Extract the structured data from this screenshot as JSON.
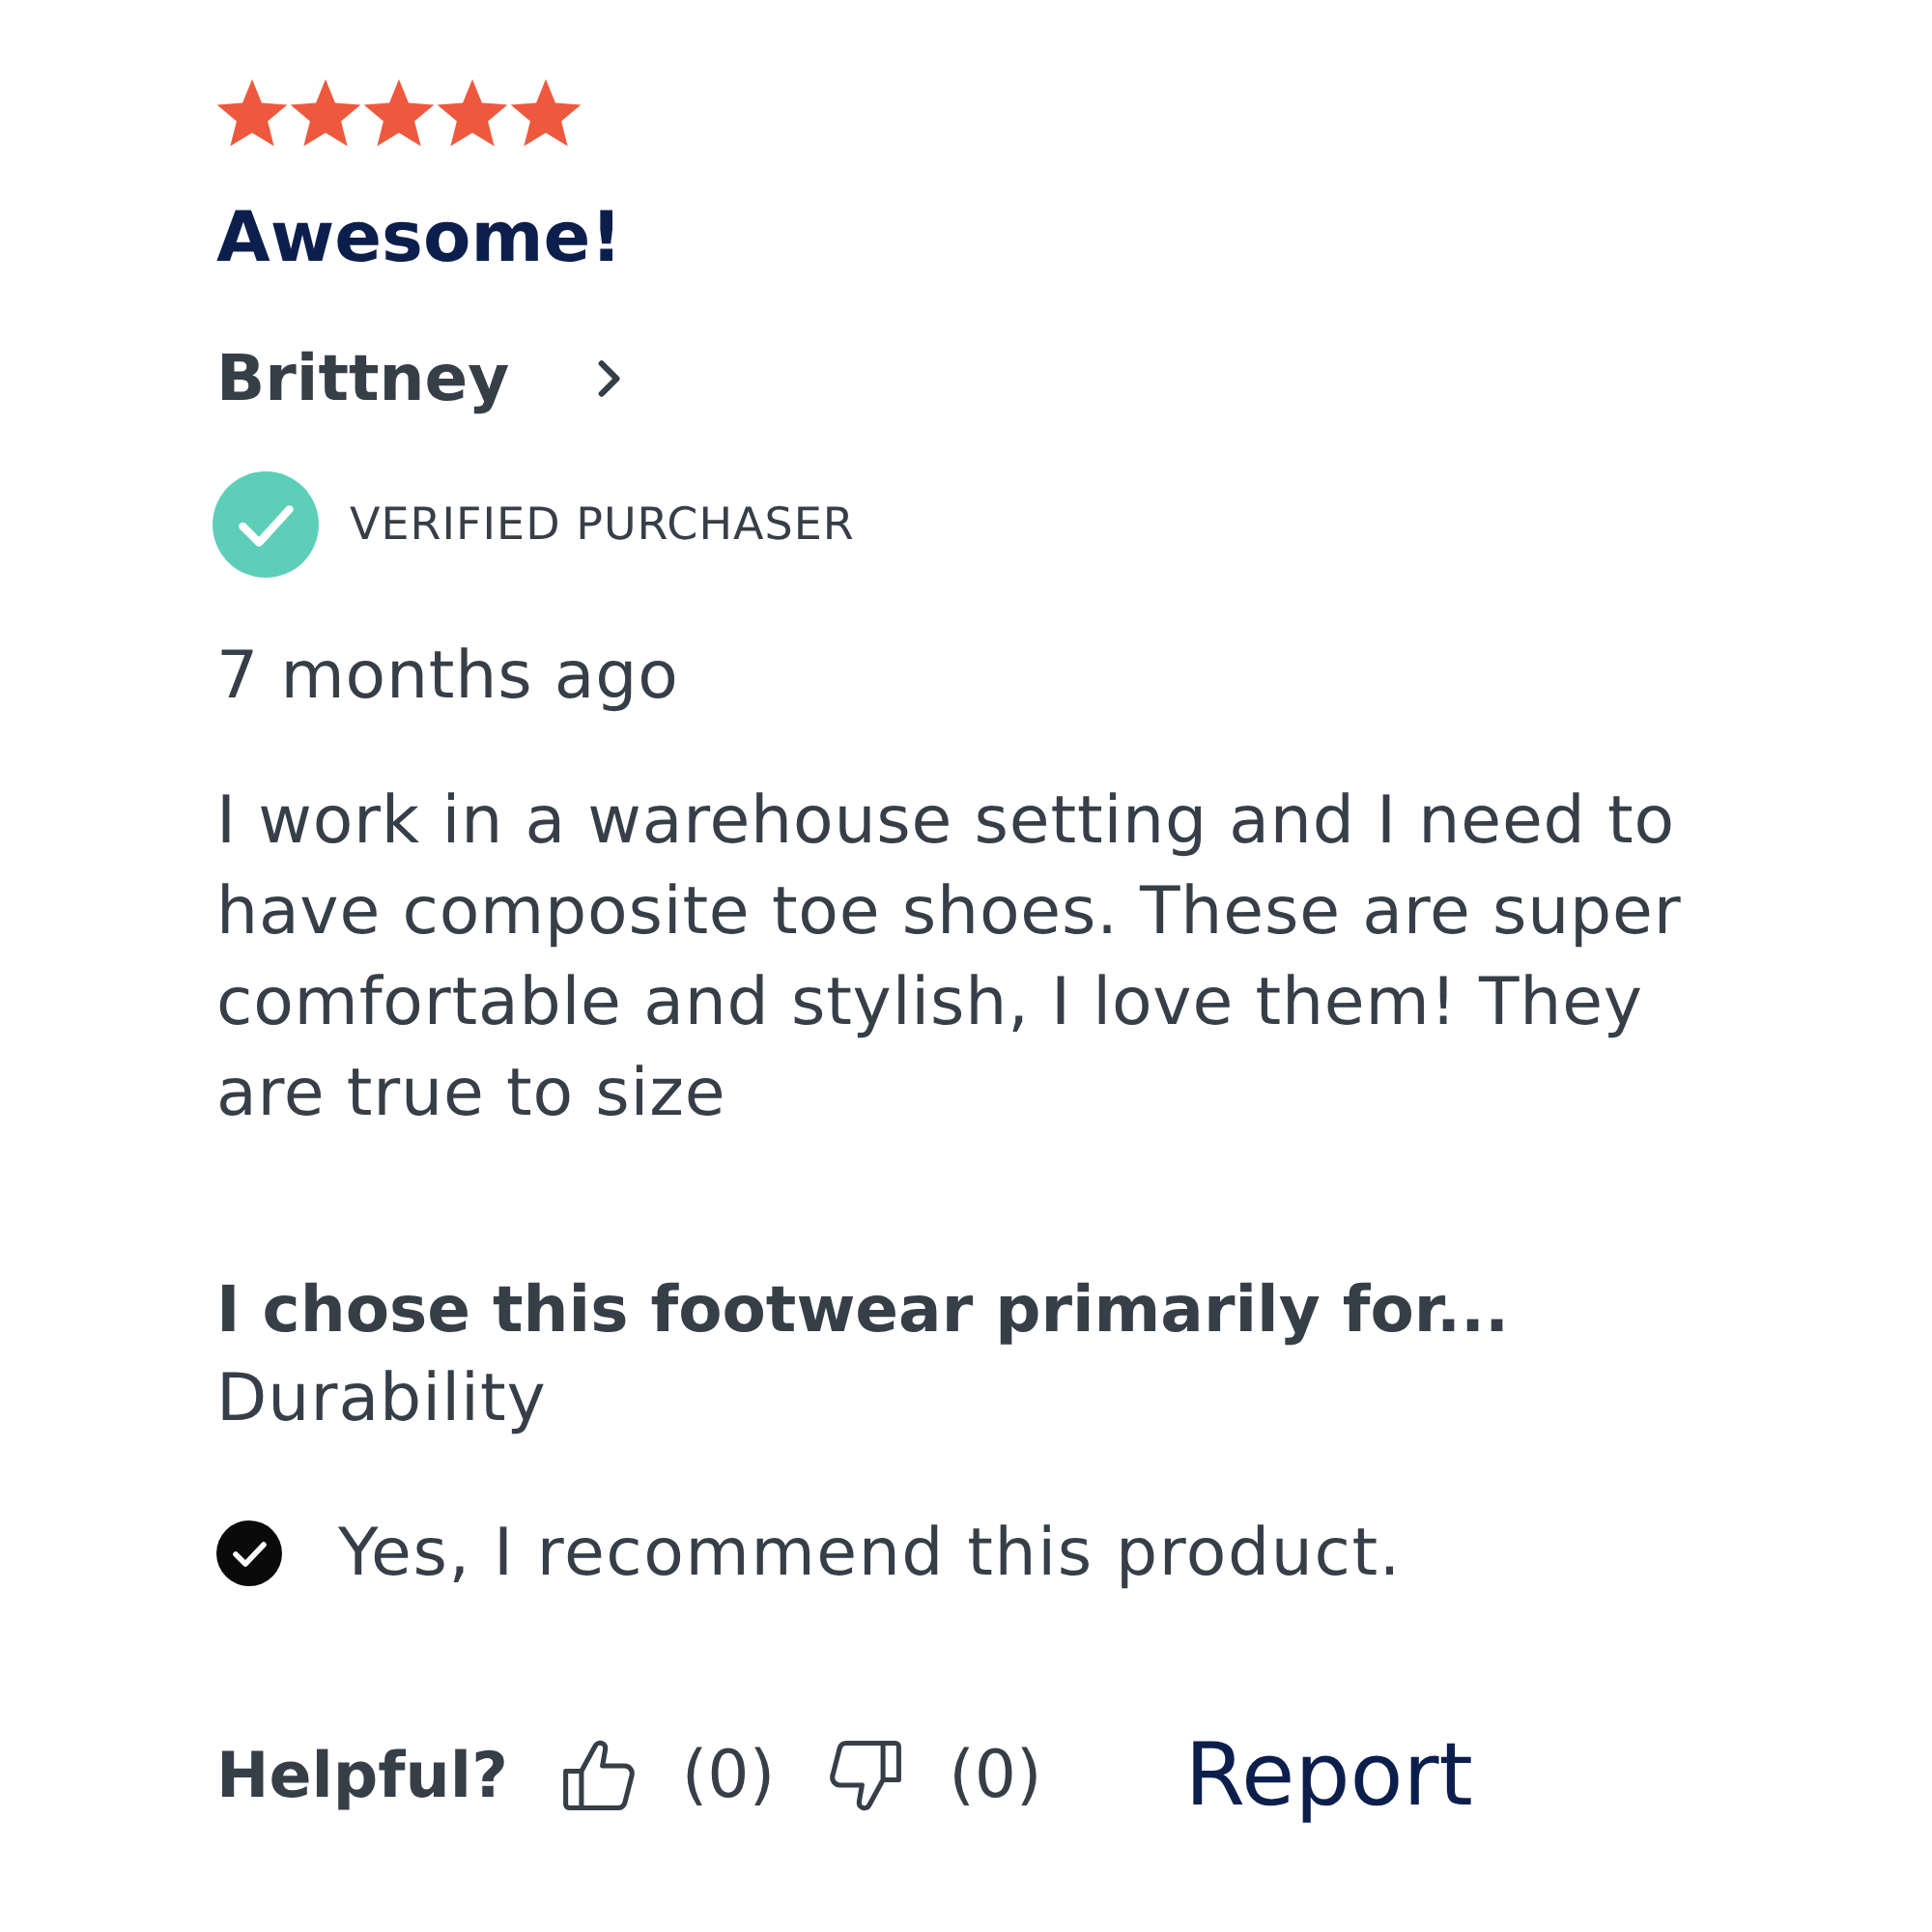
{
  "review": {
    "stars": 5,
    "title": "Awesome!",
    "reviewer": {
      "name": "Brittney"
    },
    "badge": {
      "label": "VERIFIED PURCHASER"
    },
    "time": "7 months ago",
    "body": "I work in a warehouse setting and I need to have composite toe shoes. These are super comfortable and stylish, I love them! They are true to size",
    "question": {
      "label": "I chose this footwear primarily for...",
      "answer": "Durability"
    },
    "recommendation": "Yes, I recommend this product.",
    "helpful": {
      "label": "Helpful?",
      "up_count": "(0)",
      "down_count": "(0)"
    },
    "report": "Report"
  }
}
